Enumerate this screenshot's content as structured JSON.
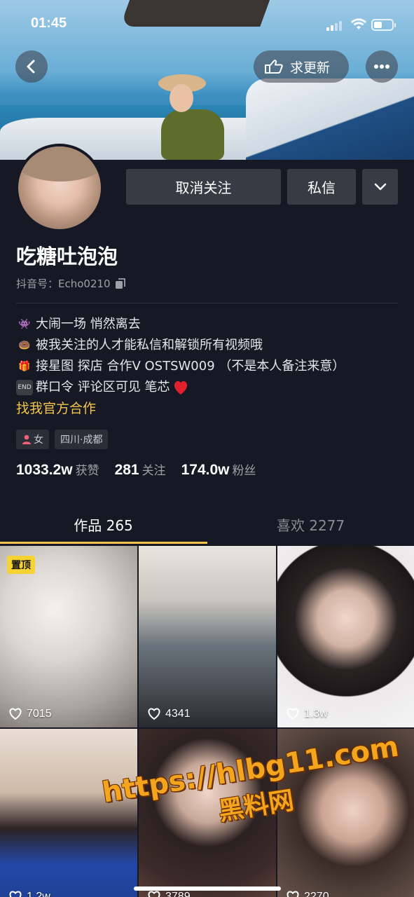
{
  "status_bar": {
    "time": "01:45"
  },
  "header": {
    "request_update_label": "求更新"
  },
  "profile": {
    "unfollow_label": "取消关注",
    "message_label": "私信",
    "nickname": "吃糖吐泡泡",
    "douyin_id_label": "抖音号：",
    "douyin_id": "Echo0210",
    "bio_lines": [
      {
        "icon": "alien-monster-icon",
        "text": "大闹一场 悄然离去"
      },
      {
        "icon": "donut-icon",
        "text": "被我关注的人才能私信和解锁所有视频哦"
      },
      {
        "icon": "gift-icon",
        "text": "接星图 探店 合作V   OSTSW009 （不是本人备注来意）"
      },
      {
        "icon": "end-arrow-icon",
        "text": "群口令 评论区可见 笔芯"
      }
    ],
    "official_link": "找我官方合作",
    "tags": {
      "gender": "女",
      "location": "四川·成都"
    },
    "stats": [
      {
        "value": "1033.2w",
        "label": "获赞"
      },
      {
        "value": "281",
        "label": "关注"
      },
      {
        "value": "174.0w",
        "label": "粉丝"
      }
    ]
  },
  "tabs": [
    {
      "label": "作品 265",
      "active": true
    },
    {
      "label": "喜欢 2277",
      "active": false
    }
  ],
  "videos": [
    {
      "likes": "7015",
      "pinned_label": "置顶"
    },
    {
      "likes": "4341"
    },
    {
      "likes": "1.3w"
    },
    {
      "likes": "1.2w"
    },
    {
      "likes": "3789"
    },
    {
      "likes": "2270"
    }
  ],
  "watermark": {
    "url": "https://hlbg11.com",
    "name": "黑料网"
  },
  "colors": {
    "background": "#161823",
    "accent": "#f3c54c",
    "button": "#393b44"
  }
}
